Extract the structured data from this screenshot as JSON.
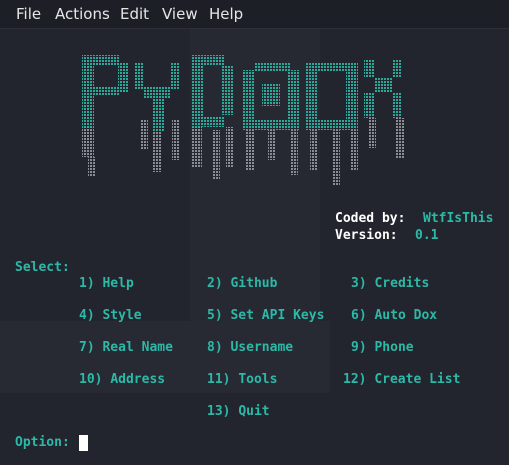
{
  "menu": {
    "file": "File",
    "actions": "Actions",
    "edit": "Edit",
    "view": "View",
    "help": "Help"
  },
  "banner": {
    "logo_text": "PYDOX",
    "coded_by_label": "Coded by:",
    "coded_by_value": "WtfIsThis",
    "version_label": "Version:",
    "version_value": "0.1"
  },
  "select_label": "Select:",
  "options": [
    {
      "num": "1)",
      "label": "Help"
    },
    {
      "num": "2)",
      "label": "Github"
    },
    {
      "num": "3)",
      "label": "Credits"
    },
    {
      "num": "4)",
      "label": "Style"
    },
    {
      "num": "5)",
      "label": "Set API Keys"
    },
    {
      "num": "6)",
      "label": "Auto Dox"
    },
    {
      "num": "7)",
      "label": "Real Name"
    },
    {
      "num": "8)",
      "label": "Username"
    },
    {
      "num": "9)",
      "label": "Phone"
    },
    {
      "num": "10)",
      "label": "Address"
    },
    {
      "num": "11)",
      "label": "Tools"
    },
    {
      "num": "12)",
      "label": "Create List"
    },
    {
      "num": "13)",
      "label": "Quit"
    }
  ],
  "prompt": {
    "label": "Option:",
    "value": ""
  },
  "colors": {
    "accent": "#2bb9a8",
    "background": "#23252e",
    "text": "#ffffff"
  }
}
